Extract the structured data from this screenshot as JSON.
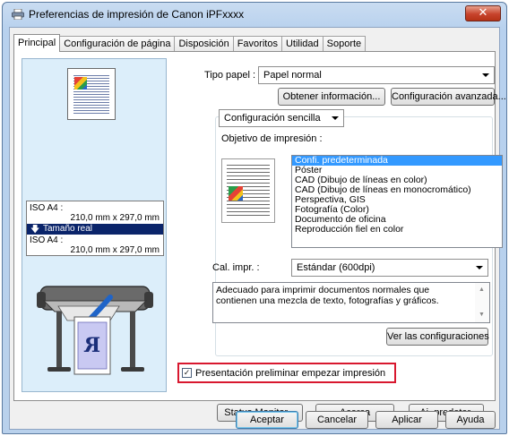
{
  "window": {
    "title": "Preferencias de impresión de Canon iPFxxxx",
    "close_glyph": "✕"
  },
  "tabs": [
    "Principal",
    "Configuración de página",
    "Disposición",
    "Favoritos",
    "Utilidad",
    "Soporte"
  ],
  "preview": {
    "size_top_label": "ISO A4 :",
    "size_top_value": "210,0 mm x 297,0 mm",
    "selected_label": "Tamaño real",
    "size_bottom_label": "ISO A4 :",
    "size_bottom_value": "210,0 mm x 297,0 mm",
    "paper_letter": "R"
  },
  "form": {
    "paper_type_label": "Tipo papel :",
    "paper_type_value": "Papel normal",
    "get_info_button": "Obtener información...",
    "advanced_button": "Configuración avanzada...",
    "mode_value": "Configuración sencilla",
    "purpose_label": "Objetivo de impresión :",
    "purpose_items": [
      "Confi. predeterminada",
      "Póster",
      "CAD (Dibujo de líneas en color)",
      "CAD (Dibujo de líneas en monocromático)",
      "Perspectiva, GIS",
      "Fotografía (Color)",
      "Documento de oficina",
      "Reproducción fiel en color"
    ],
    "quality_label": "Cal. impr. :",
    "quality_value": "Estándar (600dpi)",
    "description": "Adecuado para imprimir documentos normales que contienen una mezcla de texto, fotografías y gráficos.",
    "view_settings_button": "Ver las configuraciones",
    "preview_checkbox_label": "Presentación preliminar empezar impresión",
    "preview_checkbox_checked": true
  },
  "bottom_buttons": {
    "status_monitor": "Status Monitor...",
    "about": "Acerca",
    "defaults": "Aj. predeter."
  },
  "dialog_buttons": {
    "ok": "Aceptar",
    "cancel": "Cancelar",
    "apply": "Aplicar",
    "help": "Ayuda"
  },
  "colors": {
    "selection": "#3399ff",
    "highlight_border": "#d8182f",
    "preview_bg": "#dceefa"
  }
}
